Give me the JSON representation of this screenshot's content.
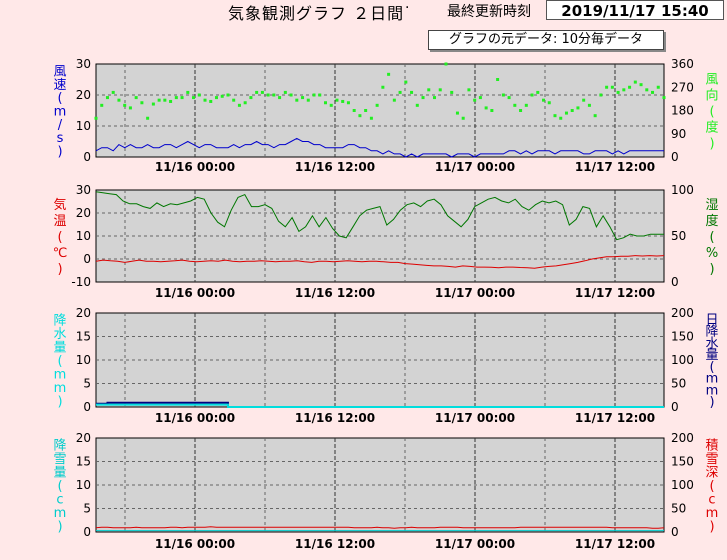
{
  "header": {
    "title": "気象観測グラフ ２日間",
    "dot": "·",
    "updated_label": "最終更新時刻",
    "updated_time": "2019/11/17 15:40",
    "data_interval_label": "グラフの元データ: 10分毎データ"
  },
  "colors": {
    "background": "#ffe8e8",
    "plot_bg": "#d3d3d3",
    "wind_speed": "#0000cc",
    "wind_direction": "#22ee22",
    "temperature": "#dd0000",
    "humidity": "#007700",
    "precip": "#00dddd",
    "precip_daily": "#000080",
    "snow_fall": "#00cccc",
    "snow_depth": "#dd0000"
  },
  "chart_data": [
    {
      "type": "line",
      "x_tick_labels": [
        "11/16 00:00",
        "11/16 12:00",
        "11/17 00:00",
        "11/17 12:00"
      ],
      "left_axis": {
        "label": "風速(m/s)",
        "ylim": [
          0,
          30
        ],
        "ticks": [
          "0",
          "10",
          "20",
          "30"
        ]
      },
      "right_axis": {
        "label": "風向(度)",
        "ylim": [
          0,
          360
        ],
        "ticks": [
          "0",
          "90",
          "180",
          "270",
          "360"
        ]
      },
      "series": [
        {
          "axis": "left",
          "style": "line",
          "color_key": "wind_speed",
          "values": [
            2,
            3,
            3,
            2,
            4,
            3,
            4,
            3,
            3,
            4,
            3,
            3,
            4,
            4,
            3,
            4,
            5,
            4,
            3,
            4,
            4,
            3,
            3,
            3,
            4,
            3,
            4,
            4,
            5,
            4,
            4,
            3,
            4,
            4,
            5,
            6,
            5,
            5,
            4,
            4,
            3,
            3,
            3,
            3,
            4,
            4,
            3,
            3,
            2,
            2,
            1,
            2,
            1,
            1,
            0,
            1,
            0,
            1,
            1,
            1,
            1,
            1,
            0,
            1,
            1,
            1,
            0,
            1,
            1,
            1,
            1,
            1,
            2,
            2,
            1,
            2,
            1,
            2,
            2,
            2,
            1,
            2,
            2,
            2,
            2,
            1,
            1,
            2,
            2,
            2,
            1,
            2,
            1,
            2,
            2,
            2,
            2,
            2,
            2,
            2
          ]
        },
        {
          "axis": "right",
          "style": "dots",
          "color_key": "wind_direction",
          "values": [
            150,
            200,
            230,
            250,
            220,
            200,
            190,
            230,
            210,
            150,
            205,
            220,
            220,
            215,
            230,
            230,
            250,
            230,
            240,
            220,
            215,
            230,
            235,
            240,
            220,
            200,
            210,
            230,
            250,
            250,
            240,
            240,
            230,
            250,
            240,
            220,
            230,
            220,
            240,
            240,
            210,
            200,
            220,
            215,
            210,
            180,
            160,
            180,
            150,
            200,
            270,
            320,
            220,
            250,
            290,
            250,
            200,
            230,
            260,
            230,
            260,
            360,
            250,
            170,
            150,
            260,
            220,
            230,
            190,
            180,
            300,
            240,
            230,
            200,
            180,
            200,
            240,
            250,
            220,
            210,
            160,
            150,
            170,
            180,
            190,
            220,
            200,
            160,
            240,
            270,
            270,
            250,
            260,
            270,
            290,
            280,
            260,
            250,
            270,
            230
          ]
        }
      ]
    },
    {
      "type": "line",
      "x_tick_labels": [
        "11/16 00:00",
        "11/16 12:00",
        "11/17 00:00",
        "11/17 12:00"
      ],
      "left_axis": {
        "label": "気温(℃)",
        "ylim": [
          -10,
          30
        ],
        "ticks": [
          "-10",
          "0",
          "10",
          "20",
          "30"
        ]
      },
      "right_axis": {
        "label": "湿度(%)",
        "ylim": [
          0,
          100
        ],
        "ticks": [
          "0",
          "50",
          "100"
        ]
      },
      "series": [
        {
          "axis": "left",
          "style": "line",
          "color_key": "temperature",
          "values": [
            -1,
            -0.5,
            -0.8,
            -1,
            -1.5,
            -1,
            -0.5,
            -1,
            -1,
            -1.2,
            -1,
            -0.8,
            -0.5,
            -1,
            -1.2,
            -1,
            -0.8,
            -1,
            -0.5,
            -1,
            -1.2,
            -1,
            -1,
            -0.8,
            -1,
            -1.2,
            -1,
            -1,
            -0.8,
            -1.2,
            -1.5,
            -1,
            -1,
            -1.2,
            -1,
            -0.8,
            -1,
            -1.2,
            -1,
            -1,
            -1.2,
            -1.5,
            -1.5,
            -2,
            -2.2,
            -2.5,
            -2.8,
            -3,
            -3,
            -3.2,
            -3.5,
            -3,
            -3.2,
            -3.5,
            -3.5,
            -3.6,
            -3.8,
            -3.5,
            -3.5,
            -3.7,
            -3.8,
            -4,
            -3.5,
            -3.2,
            -3,
            -2.5,
            -2,
            -1.5,
            -0.8,
            0,
            0.5,
            1,
            1,
            1.2,
            1.2,
            1.5,
            1.3,
            1.5,
            1.3,
            1.5
          ]
        },
        {
          "axis": "right",
          "style": "line",
          "color_key": "humidity",
          "values": [
            98,
            97,
            96,
            95,
            88,
            85,
            85,
            82,
            80,
            86,
            82,
            85,
            84,
            86,
            88,
            92,
            90,
            75,
            65,
            60,
            78,
            92,
            95,
            82,
            82,
            84,
            80,
            66,
            60,
            70,
            55,
            60,
            72,
            60,
            70,
            58,
            50,
            48,
            60,
            72,
            78,
            80,
            82,
            62,
            68,
            78,
            84,
            86,
            82,
            88,
            90,
            84,
            72,
            66,
            60,
            68,
            82,
            86,
            90,
            92,
            88,
            86,
            90,
            82,
            78,
            84,
            88,
            86,
            88,
            84,
            62,
            68,
            82,
            80,
            60,
            72,
            60,
            46,
            48,
            52,
            50,
            50,
            52,
            52,
            52
          ]
        }
      ]
    },
    {
      "type": "line",
      "x_tick_labels": [
        "11/16 00:00",
        "11/16 12:00",
        "11/17 00:00",
        "11/17 12:00"
      ],
      "left_axis": {
        "label": "降水量(mm)",
        "ylim": [
          0,
          20
        ],
        "ticks": [
          "0",
          "5",
          "10",
          "15",
          "20"
        ]
      },
      "right_axis": {
        "label": "日降水量(mm)",
        "ylim": [
          0,
          200
        ],
        "ticks": [
          "0",
          "50",
          "100",
          "150",
          "200"
        ]
      },
      "series": [
        {
          "axis": "right",
          "style": "step",
          "color_key": "precip_daily",
          "values": [
            7,
            7,
            9,
            9,
            9,
            9,
            9,
            9,
            9,
            9,
            9,
            9,
            9,
            9,
            9,
            9,
            9,
            9,
            9,
            9,
            9,
            9,
            9,
            0,
            0,
            0,
            0,
            0,
            0,
            0,
            0,
            0,
            0,
            0,
            0,
            0,
            0,
            0,
            0,
            0,
            0,
            0,
            0,
            0,
            0,
            0,
            0,
            0,
            0,
            0,
            0,
            0,
            0,
            0,
            0,
            0,
            0,
            0,
            0,
            0,
            0,
            0,
            0,
            0,
            0,
            0,
            0,
            0,
            0,
            0,
            0,
            0,
            0,
            0,
            0,
            0,
            0,
            0,
            0,
            0,
            0,
            0,
            0,
            0,
            0,
            0,
            0,
            0,
            0,
            0,
            0,
            0,
            0,
            0,
            0,
            0,
            0,
            0,
            0,
            0
          ]
        },
        {
          "axis": "left",
          "style": "step",
          "color_key": "precip",
          "values": [
            0.5,
            0.5,
            0.5,
            0.5,
            0.5,
            0.5,
            0.5,
            0.5,
            0.5,
            0.5,
            0.5,
            0.5,
            0.5,
            0.5,
            0.5,
            0.5,
            0.5,
            0.5,
            0.5,
            0.5,
            0.5,
            0.5,
            0.5,
            0,
            0,
            0,
            0,
            0,
            0,
            0,
            0,
            0,
            0,
            0,
            0,
            0,
            0,
            0,
            0,
            0,
            0,
            0,
            0,
            0,
            0,
            0,
            0,
            0,
            0,
            0,
            0,
            0,
            0,
            0,
            0,
            0,
            0,
            0,
            0,
            0,
            0,
            0,
            0,
            0,
            0,
            0,
            0,
            0,
            0,
            0,
            0,
            0,
            0,
            0,
            0,
            0,
            0,
            0,
            0,
            0,
            0,
            0,
            0,
            0,
            0,
            0,
            0,
            0,
            0,
            0,
            0,
            0,
            0,
            0,
            0,
            0,
            0,
            0,
            0,
            0
          ]
        }
      ]
    },
    {
      "type": "line",
      "x_tick_labels": [
        "11/16 00:00",
        "11/16 12:00",
        "11/17 00:00",
        "11/17 12:00"
      ],
      "left_axis": {
        "label": "降雪量(cm)",
        "ylim": [
          0,
          20
        ],
        "ticks": [
          "0",
          "5",
          "10",
          "15",
          "20"
        ]
      },
      "right_axis": {
        "label": "積雪深(cm)",
        "ylim": [
          0,
          200
        ],
        "ticks": [
          "0",
          "50",
          "100",
          "150",
          "200"
        ]
      },
      "series": [
        {
          "axis": "right",
          "style": "line",
          "color_key": "snow_depth",
          "values": [
            9,
            10,
            10,
            9,
            9,
            9,
            9,
            10,
            9,
            9,
            9,
            9,
            9,
            10,
            10,
            9,
            10,
            10,
            10,
            10,
            11,
            10,
            10,
            10,
            10,
            10,
            10,
            10,
            10,
            10,
            10,
            10,
            10,
            10,
            10,
            10,
            10,
            10,
            10,
            10,
            10,
            10,
            10,
            10,
            10,
            9,
            9,
            9,
            9,
            10,
            9,
            9,
            8,
            9,
            9,
            10,
            9,
            9,
            9,
            9,
            10,
            10,
            10,
            10,
            9,
            9,
            9,
            9,
            9,
            9,
            9,
            9,
            9,
            9,
            10,
            10,
            10,
            10,
            10,
            10,
            10,
            10,
            10,
            10,
            10,
            10,
            10,
            10,
            10,
            10,
            9,
            9,
            9,
            9,
            9,
            9,
            9,
            8,
            8,
            9
          ]
        },
        {
          "axis": "left",
          "style": "line",
          "color_key": "snow_fall",
          "values": [
            0.3,
            0.3,
            0.3,
            0.3,
            0.3,
            0.3,
            0.3,
            0.3,
            0.3,
            0.3,
            0.3,
            0.3,
            0.3,
            0.3,
            0.3,
            0.3,
            0.3,
            0.3,
            0.3,
            0.3,
            0.3,
            0.3,
            0.3,
            0.3,
            0.3,
            0.3,
            0.3,
            0.3,
            0.3,
            0.3,
            0.3,
            0.3,
            0.3,
            0.3,
            0.3,
            0.3,
            0.3,
            0.3,
            0.3,
            0.3,
            0.3,
            0.3,
            0.3,
            0.3,
            0.3,
            0.3,
            0.3,
            0.3,
            0.3,
            0.3,
            0.3,
            0.3,
            0.3,
            0.3,
            0.3,
            0.3,
            0.3,
            0.3,
            0.3,
            0.3,
            0.3,
            0.3,
            0.3,
            0.3,
            0.3,
            0.3,
            0.3,
            0.3,
            0.3,
            0.3,
            0.3,
            0.3,
            0.3,
            0.3,
            0.3,
            0.3,
            0.3,
            0.3,
            0.3,
            0.3,
            0.3,
            0.3,
            0.3,
            0.3,
            0.3,
            0.3,
            0.3,
            0.3,
            0.3,
            0.3,
            0.3,
            0.3,
            0.3,
            0.3,
            0.3,
            0.3,
            0.3,
            0.3,
            0.3,
            0.3
          ]
        }
      ]
    }
  ]
}
